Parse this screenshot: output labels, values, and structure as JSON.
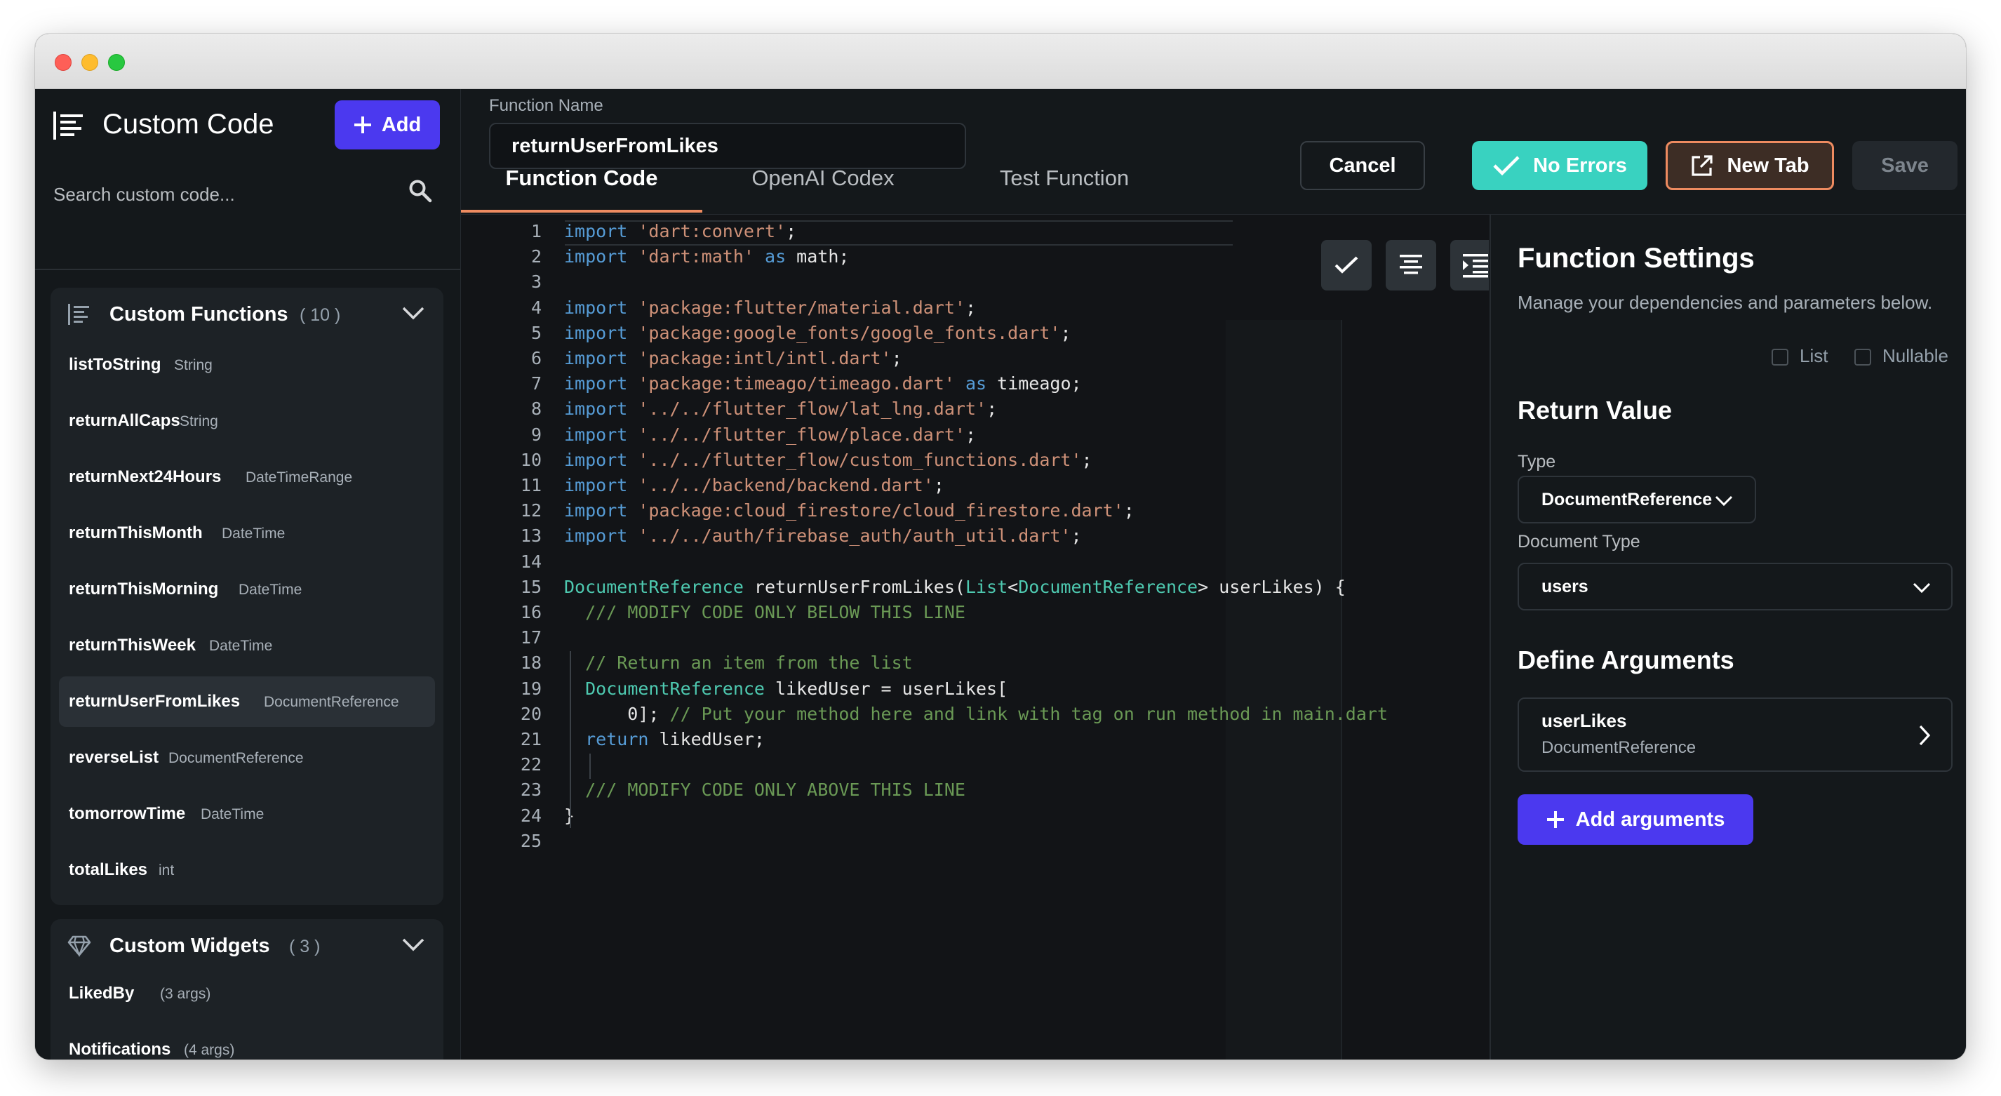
{
  "sidebar": {
    "title": "Custom Code",
    "add_label": "Add",
    "search_placeholder": "Search custom code...",
    "functions": {
      "title": "Custom Functions",
      "count": "( 10 )",
      "items": [
        {
          "name": "listToString",
          "type": "String"
        },
        {
          "name": "returnAllCaps",
          "type": "String"
        },
        {
          "name": "returnNext24Hours",
          "type": "DateTimeRange"
        },
        {
          "name": "returnThisMonth",
          "type": "DateTime"
        },
        {
          "name": "returnThisMorning",
          "type": "DateTime"
        },
        {
          "name": "returnThisWeek",
          "type": "DateTime"
        },
        {
          "name": "returnUserFromLikes",
          "type": "DocumentReference"
        },
        {
          "name": "reverseList",
          "type": "DocumentReference"
        },
        {
          "name": "tomorrowTime",
          "type": "DateTime"
        },
        {
          "name": "totalLikes",
          "type": "int"
        }
      ]
    },
    "widgets": {
      "title": "Custom Widgets",
      "count": "( 3 )",
      "items": [
        {
          "name": "LikedBy",
          "type": "(3 args)"
        },
        {
          "name": "Notifications",
          "type": "(4 args)"
        }
      ]
    }
  },
  "topbar": {
    "function_name_label": "Function Name",
    "function_name_value": "returnUserFromLikes",
    "cancel_label": "Cancel",
    "no_errors_label": "No Errors",
    "new_tab_label": "New Tab",
    "save_label": "Save"
  },
  "tabs": [
    {
      "label": "Function Code"
    },
    {
      "label": "OpenAI Codex"
    },
    {
      "label": "Test Function"
    }
  ],
  "editor": {
    "lines": [
      {
        "n": "1",
        "tokens": [
          [
            "k",
            "import"
          ],
          [
            "p",
            " "
          ],
          [
            "s",
            "'dart:convert'"
          ],
          [
            "p",
            ";"
          ]
        ]
      },
      {
        "n": "2",
        "tokens": [
          [
            "k",
            "import"
          ],
          [
            "p",
            " "
          ],
          [
            "s",
            "'dart:math'"
          ],
          [
            "p",
            " "
          ],
          [
            "k",
            "as"
          ],
          [
            "p",
            " math;"
          ]
        ]
      },
      {
        "n": "3",
        "tokens": []
      },
      {
        "n": "4",
        "tokens": [
          [
            "k",
            "import"
          ],
          [
            "p",
            " "
          ],
          [
            "s",
            "'package:flutter/material.dart'"
          ],
          [
            "p",
            ";"
          ]
        ]
      },
      {
        "n": "5",
        "tokens": [
          [
            "k",
            "import"
          ],
          [
            "p",
            " "
          ],
          [
            "s",
            "'package:google_fonts/google_fonts.dart'"
          ],
          [
            "p",
            ";"
          ]
        ]
      },
      {
        "n": "6",
        "tokens": [
          [
            "k",
            "import"
          ],
          [
            "p",
            " "
          ],
          [
            "s",
            "'package:intl/intl.dart'"
          ],
          [
            "p",
            ";"
          ]
        ]
      },
      {
        "n": "7",
        "tokens": [
          [
            "k",
            "import"
          ],
          [
            "p",
            " "
          ],
          [
            "s",
            "'package:timeago/timeago.dart'"
          ],
          [
            "p",
            " "
          ],
          [
            "k",
            "as"
          ],
          [
            "p",
            " timeago;"
          ]
        ]
      },
      {
        "n": "8",
        "tokens": [
          [
            "k",
            "import"
          ],
          [
            "p",
            " "
          ],
          [
            "s",
            "'../../flutter_flow/lat_lng.dart'"
          ],
          [
            "p",
            ";"
          ]
        ]
      },
      {
        "n": "9",
        "tokens": [
          [
            "k",
            "import"
          ],
          [
            "p",
            " "
          ],
          [
            "s",
            "'../../flutter_flow/place.dart'"
          ],
          [
            "p",
            ";"
          ]
        ]
      },
      {
        "n": "10",
        "tokens": [
          [
            "k",
            "import"
          ],
          [
            "p",
            " "
          ],
          [
            "s",
            "'../../flutter_flow/custom_functions.dart'"
          ],
          [
            "p",
            ";"
          ]
        ]
      },
      {
        "n": "11",
        "tokens": [
          [
            "k",
            "import"
          ],
          [
            "p",
            " "
          ],
          [
            "s",
            "'../../backend/backend.dart'"
          ],
          [
            "p",
            ";"
          ]
        ]
      },
      {
        "n": "12",
        "tokens": [
          [
            "k",
            "import"
          ],
          [
            "p",
            " "
          ],
          [
            "s",
            "'package:cloud_firestore/cloud_firestore.dart'"
          ],
          [
            "p",
            ";"
          ]
        ]
      },
      {
        "n": "13",
        "tokens": [
          [
            "k",
            "import"
          ],
          [
            "p",
            " "
          ],
          [
            "s",
            "'../../auth/firebase_auth/auth_util.dart'"
          ],
          [
            "p",
            ";"
          ]
        ]
      },
      {
        "n": "14",
        "tokens": []
      },
      {
        "n": "15",
        "tokens": [
          [
            "t",
            "DocumentReference"
          ],
          [
            "p",
            " returnUserFromLikes("
          ],
          [
            "t",
            "List"
          ],
          [
            "p",
            "<"
          ],
          [
            "t",
            "DocumentReference"
          ],
          [
            "p",
            "> userLikes) {"
          ]
        ]
      },
      {
        "n": "16",
        "tokens": [
          [
            "p",
            "  "
          ],
          [
            "c",
            "/// MODIFY CODE ONLY BELOW THIS LINE"
          ]
        ]
      },
      {
        "n": "17",
        "tokens": []
      },
      {
        "n": "18",
        "tokens": [
          [
            "p",
            "  "
          ],
          [
            "c",
            "// Return an item from the list"
          ]
        ]
      },
      {
        "n": "19",
        "tokens": [
          [
            "p",
            "  "
          ],
          [
            "t",
            "DocumentReference"
          ],
          [
            "p",
            " likedUser = userLikes["
          ]
        ]
      },
      {
        "n": "20",
        "tokens": [
          [
            "p",
            "      0]; "
          ],
          [
            "c",
            "// Put your method here and link with tag on run method in main.dart"
          ]
        ]
      },
      {
        "n": "21",
        "tokens": [
          [
            "p",
            "  "
          ],
          [
            "k",
            "return"
          ],
          [
            "p",
            " likedUser;"
          ]
        ]
      },
      {
        "n": "22",
        "tokens": []
      },
      {
        "n": "23",
        "tokens": [
          [
            "p",
            "  "
          ],
          [
            "c",
            "/// MODIFY CODE ONLY ABOVE THIS LINE"
          ]
        ]
      },
      {
        "n": "24",
        "tokens": [
          [
            "p",
            "}"
          ]
        ]
      },
      {
        "n": "25",
        "tokens": []
      }
    ]
  },
  "settings": {
    "title": "Function Settings",
    "subtitle": "Manage your dependencies and parameters below.",
    "return_value_title": "Return Value",
    "type_label": "Type",
    "type_value": "DocumentReference",
    "list_label": "List",
    "nullable_label": "Nullable",
    "document_type_label": "Document Type",
    "document_type_value": "users",
    "define_args_title": "Define Arguments",
    "arg_name": "userLikes",
    "arg_type": "DocumentReference",
    "add_args_label": "Add arguments"
  },
  "colors": {
    "accent": "#4b39ef",
    "success": "#39d2c0",
    "tab_underline": "#ee8b60"
  }
}
